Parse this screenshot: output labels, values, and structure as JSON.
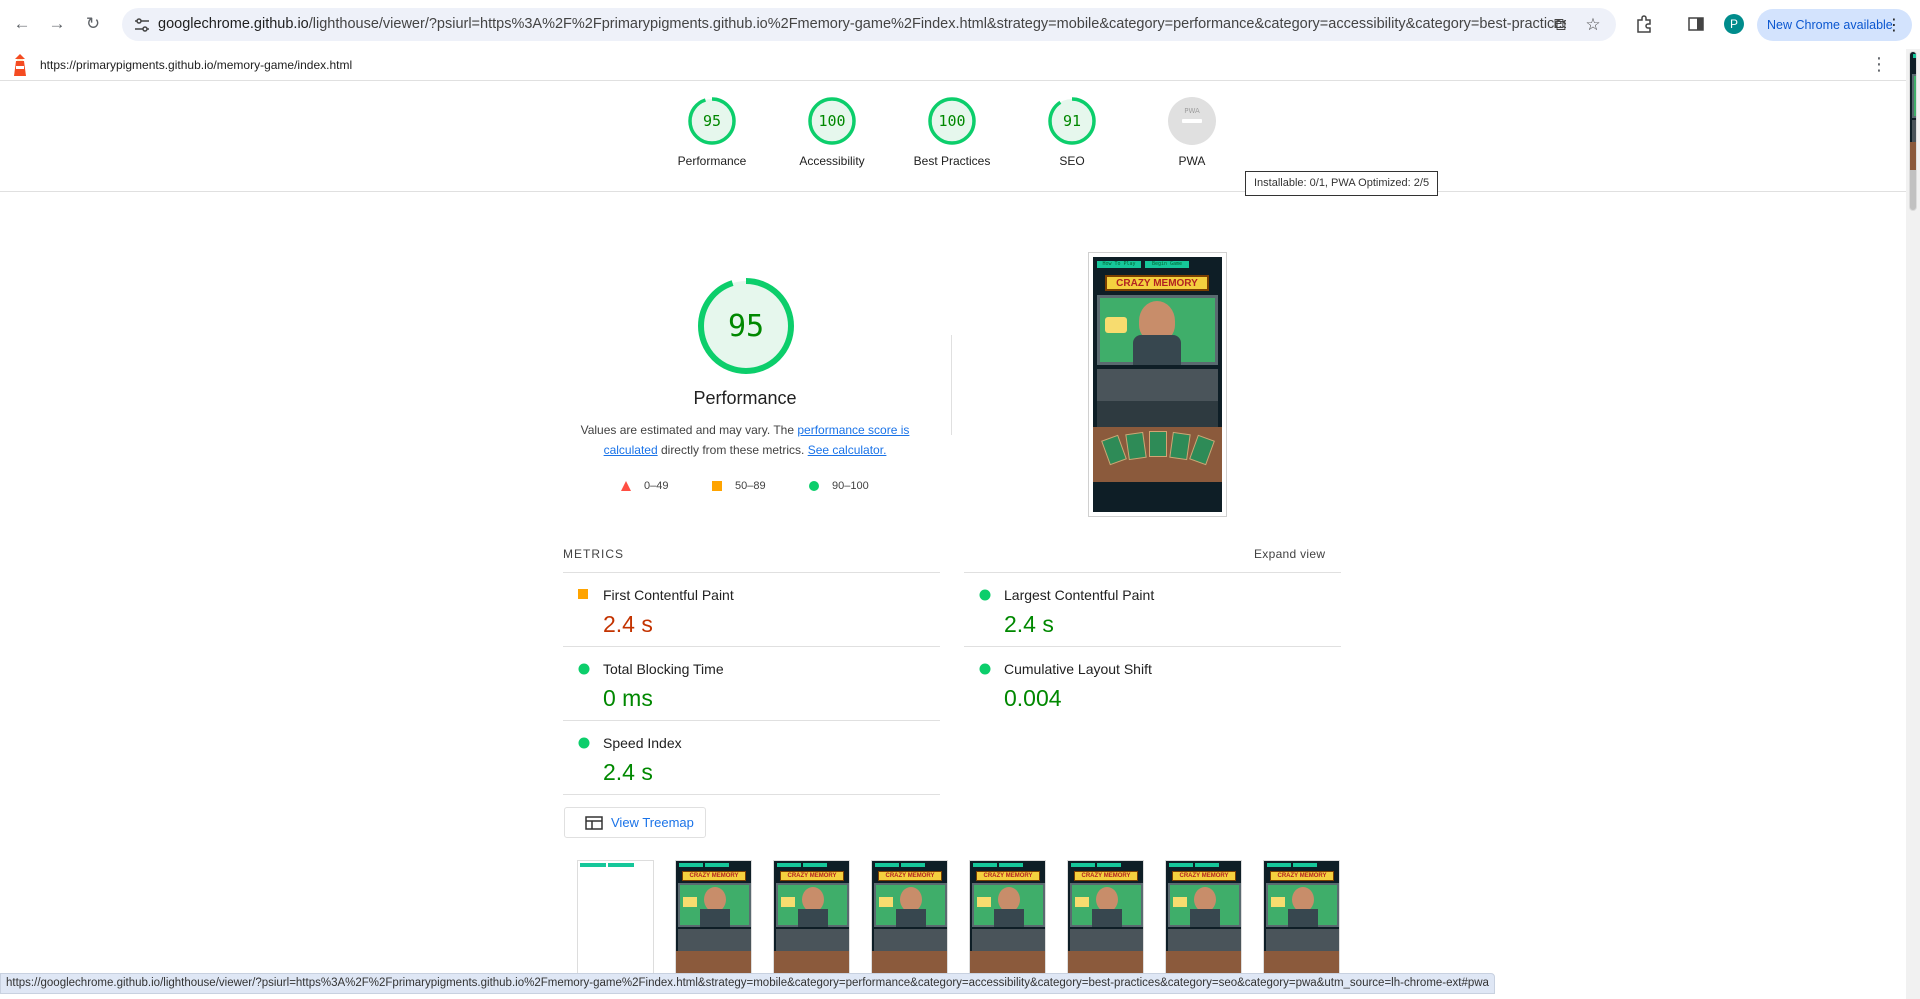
{
  "browser": {
    "url_host": "googlechrome.github.io",
    "url_rest": "/lighthouse/viewer/?psiurl=https%3A%2F%2Fprimarypigments.github.io%2Fmemory-game%2Findex.html&strategy=mobile&category=performance&category=accessibility&category=best-practices...",
    "avatar_letter": "P",
    "new_chrome_label": "New Chrome available"
  },
  "lighthouse": {
    "tested_url": "https://primarypigments.github.io/memory-game/index.html",
    "gauges": [
      {
        "score": "95",
        "label": "Performance",
        "value": 0.95
      },
      {
        "score": "100",
        "label": "Accessibility",
        "value": 1.0
      },
      {
        "score": "100",
        "label": "Best Practices",
        "value": 1.0
      },
      {
        "score": "91",
        "label": "SEO",
        "value": 0.91
      }
    ],
    "pwa": {
      "badge": "PWA",
      "label": "PWA",
      "tooltip": "Installable: 0/1, PWA Optimized: 2/5"
    },
    "performance": {
      "score": "95",
      "value": 0.95,
      "title": "Performance",
      "desc_prefix": "Values are estimated and may vary. The ",
      "desc_link1": "performance score is calculated",
      "desc_mid": " directly from these metrics. ",
      "desc_link2": "See calculator.",
      "legend": [
        "0–49",
        "50–89",
        "90–100"
      ]
    },
    "metrics_header": "METRICS",
    "expand_view": "Expand view",
    "metrics": [
      {
        "name": "First Contentful Paint",
        "value": "2.4 s",
        "rating": "average"
      },
      {
        "name": "Largest Contentful Paint",
        "value": "2.4 s",
        "rating": "pass"
      },
      {
        "name": "Total Blocking Time",
        "value": "0 ms",
        "rating": "pass"
      },
      {
        "name": "Cumulative Layout Shift",
        "value": "0.004",
        "rating": "pass"
      },
      {
        "name": "Speed Index",
        "value": "2.4 s",
        "rating": "pass"
      }
    ],
    "treemap_label": "View Treemap",
    "screenshot_title": "CRAZY MEMORY",
    "screenshot_buttons": [
      "How To Play",
      "Begin Game"
    ]
  },
  "colors": {
    "pass": "#0cce6b",
    "pass_text": "#008800",
    "average": "#ffa400",
    "average_text": "#c33300",
    "fail": "#ff4e42",
    "link": "#1a73e8"
  },
  "status_url": "https://googlechrome.github.io/lighthouse/viewer/?psiurl=https%3A%2F%2Fprimarypigments.github.io%2Fmemory-game%2Findex.html&strategy=mobile&category=performance&category=accessibility&category=best-practices&category=seo&category=pwa&utm_source=lh-chrome-ext#pwa"
}
